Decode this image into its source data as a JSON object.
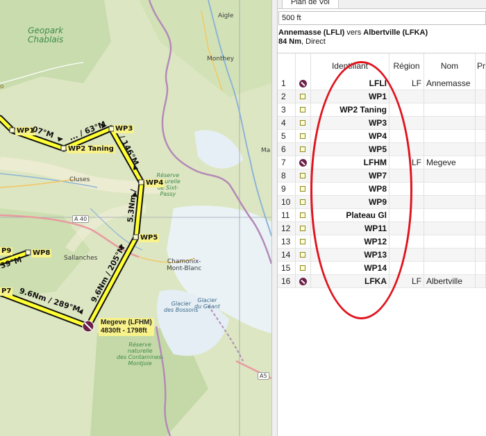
{
  "map": {
    "labels": {
      "aigle": "Aigle",
      "geopark": "Geopark\nChablais",
      "monthey": "Monthey",
      "cluses": "Cluses",
      "sallanches": "Sallanches",
      "chamonix": "Chamonix-\nMont-Blanc",
      "reserve_sixt": "Réserve\nnaturelle\nde Sixt-\nPassy",
      "reserve_contamines": "Réserve\nnaturelle\ndes Contamines-\nMontjoie",
      "glacier_bossons": "Glacier\ndes Bossons",
      "glacier_geant": "Glacier\ndu Géant",
      "road_a40": "A 40",
      "road_a5": "A5",
      "ma": "Ma",
      "left_o": "o"
    },
    "waypoints": {
      "wp1": "WP1",
      "wp2": "WP2 Taning",
      "wp3": "WP3",
      "wp4": "WP4",
      "wp5": "WP5",
      "wp8": "WP8",
      "wp9": "P9",
      "wp7": "P7"
    },
    "legs": {
      "leg_wp1_wp2": "07°M",
      "leg_wp2_wp3": "... / 63°M",
      "leg_wp3_wp4": "/ 146°M",
      "leg_wp4_wp5": "5.3Nm /",
      "leg_wp5_lfhm": "9.6Nm / 205°M",
      "leg_wp7_lfhm": "9.6Nm / 289°M",
      "leg_wp9_wp8": "39°M"
    },
    "airport_label_line1": "Megeve (LFHM)",
    "airport_label_line2": "4830ft - 1798ft"
  },
  "panel": {
    "tab_label": "Plan de Vol",
    "altitude_value": "500 ft",
    "route_from": "Annemasse (LFLI)",
    "route_vers": " vers ",
    "route_to": "Albertville (LFKA)",
    "route_dist": "84 Nm",
    "route_type": ", Direct",
    "columns": {
      "identifiant": "Identifiant",
      "region": "Région",
      "nom": "Nom",
      "pr": "Pr"
    },
    "rows": [
      {
        "num": "1",
        "icon": "airport",
        "id": "LFLI",
        "region": "LF",
        "nom": "Annemasse"
      },
      {
        "num": "2",
        "icon": "waypoint",
        "id": "WP1",
        "region": "",
        "nom": ""
      },
      {
        "num": "3",
        "icon": "waypoint",
        "id": "WP2 Taning",
        "region": "",
        "nom": ""
      },
      {
        "num": "4",
        "icon": "waypoint",
        "id": "WP3",
        "region": "",
        "nom": ""
      },
      {
        "num": "5",
        "icon": "waypoint",
        "id": "WP4",
        "region": "",
        "nom": ""
      },
      {
        "num": "6",
        "icon": "waypoint",
        "id": "WP5",
        "region": "",
        "nom": ""
      },
      {
        "num": "7",
        "icon": "airport",
        "id": "LFHM",
        "region": "LF",
        "nom": "Megeve"
      },
      {
        "num": "8",
        "icon": "waypoint",
        "id": "WP7",
        "region": "",
        "nom": ""
      },
      {
        "num": "9",
        "icon": "waypoint",
        "id": "WP8",
        "region": "",
        "nom": ""
      },
      {
        "num": "10",
        "icon": "waypoint",
        "id": "WP9",
        "region": "",
        "nom": ""
      },
      {
        "num": "11",
        "icon": "waypoint",
        "id": "Plateau Gl",
        "region": "",
        "nom": ""
      },
      {
        "num": "12",
        "icon": "waypoint",
        "id": "WP11",
        "region": "",
        "nom": ""
      },
      {
        "num": "13",
        "icon": "waypoint",
        "id": "WP12",
        "region": "",
        "nom": ""
      },
      {
        "num": "14",
        "icon": "waypoint",
        "id": "WP13",
        "region": "",
        "nom": ""
      },
      {
        "num": "15",
        "icon": "waypoint",
        "id": "WP14",
        "region": "",
        "nom": ""
      },
      {
        "num": "16",
        "icon": "airport",
        "id": "LFKA",
        "region": "LF",
        "nom": "Albertville"
      }
    ]
  },
  "colors": {
    "route_yellow": "#ffff33",
    "highlight_red": "#e0141e",
    "airport_purple": "#6b2048"
  }
}
